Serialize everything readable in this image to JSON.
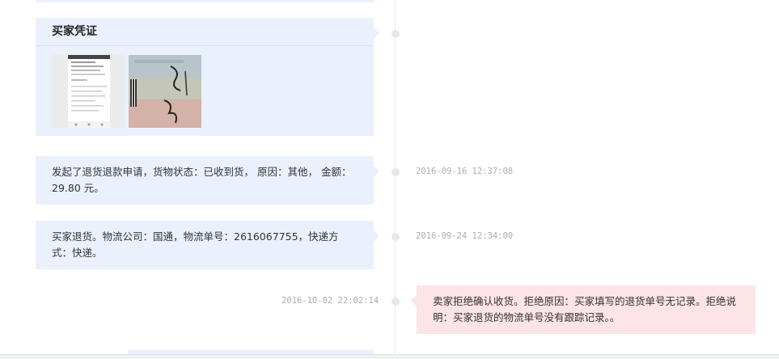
{
  "evidence": {
    "title": "买家凭证",
    "images": [
      "phone-screenshot-thumbnail",
      "shipping-label-photo-thumbnail"
    ]
  },
  "events": [
    {
      "side": "left",
      "text": "发起了退货退款申请，货物状态：已收到货， 原因：其他， 金额：29.80 元。",
      "time": "2016-09-16 12:37:08"
    },
    {
      "side": "left",
      "text": "买家退货。物流公司：国通，物流单号：2616067755，快递方式：快递。",
      "time": "2016-09-24 12:34:00"
    },
    {
      "side": "right",
      "text": "卖家拒绝确认收货。拒绝原因：买家填写的退货单号无记录。拒绝说明：买家退货的物流单号没有跟踪记录。。",
      "time": "2016-10-02 22:02:14"
    }
  ],
  "colors": {
    "buyer_card": "#eaf1fd",
    "seller_card": "#fde4e6",
    "timestamp": "#a8adb5",
    "timeline": "#e8eaee"
  }
}
